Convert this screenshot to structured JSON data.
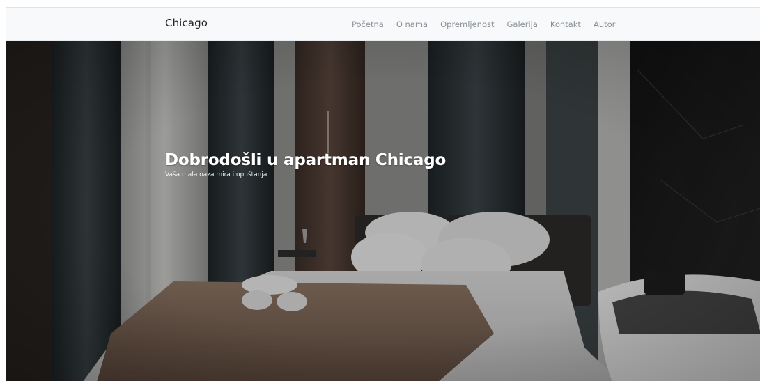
{
  "navbar": {
    "brand": "Chicago",
    "links": [
      "Početna",
      "O nama",
      "Opremljenost",
      "Galerija",
      "Kontakt",
      "Autor"
    ]
  },
  "hero": {
    "title": "Dobrodošli u apartman Chicago",
    "subtitle": "Vaša mala oaza mira i opuštanja",
    "image_description": "bedroom-with-bed-and-jacuzzi-photo"
  },
  "colors": {
    "navbar_bg": "#f8f9fa",
    "brand_text": "#212529",
    "nav_link": "#8a9096",
    "hero_text": "#ffffff"
  }
}
